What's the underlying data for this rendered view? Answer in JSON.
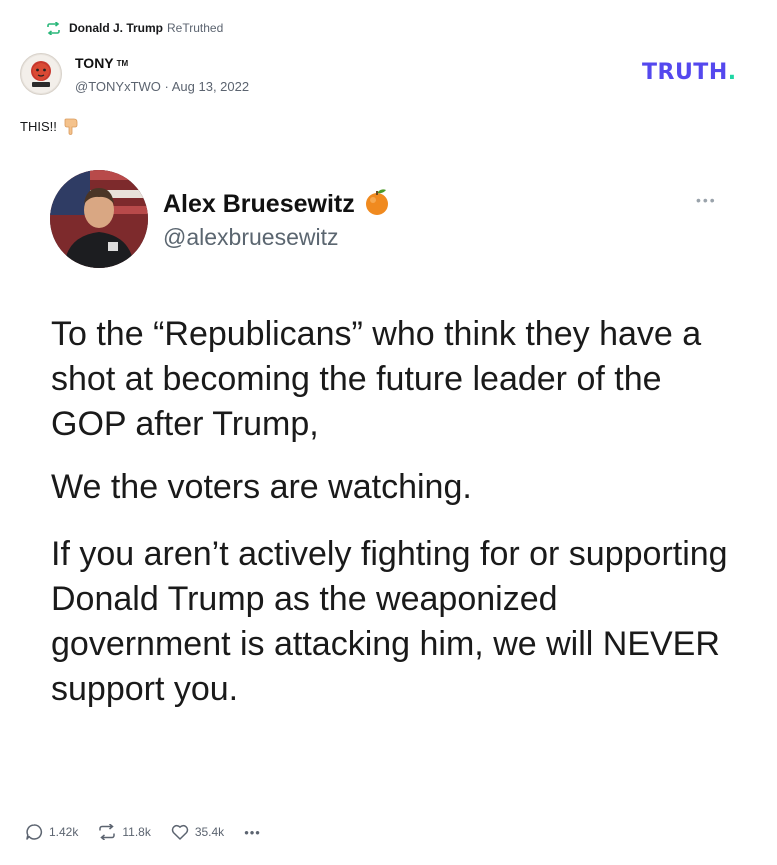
{
  "retruth": {
    "name": "Donald J. Trump",
    "label": "ReTruthed"
  },
  "author": {
    "name": "TONY",
    "tm": "TM",
    "handle": "@TONYxTWO",
    "separator": " · ",
    "date": "Aug 13, 2022"
  },
  "logo": {
    "text": "TRUTH",
    "dot": ".",
    "color": "#5448ee",
    "dot_color": "#1fd6a4"
  },
  "post": {
    "text": "THIS!!",
    "emoji": "pointing-down-hand-icon"
  },
  "tweet": {
    "name": "Alex Bruesewitz",
    "name_emoji": "orange-icon",
    "handle": "@alexbruesewitz",
    "more": "•••",
    "paragraphs": [
      "To the “Republicans” who think they have a shot at becoming the future leader of the GOP after Trump,",
      "We the voters are watching.",
      "If you aren’t actively fighting for or supporting Donald Trump as the weaponized government is attacking him, we will NEVER support you."
    ]
  },
  "actions": {
    "replies": "1.42k",
    "retruths": "11.8k",
    "likes": "35.4k",
    "more": "•••"
  }
}
